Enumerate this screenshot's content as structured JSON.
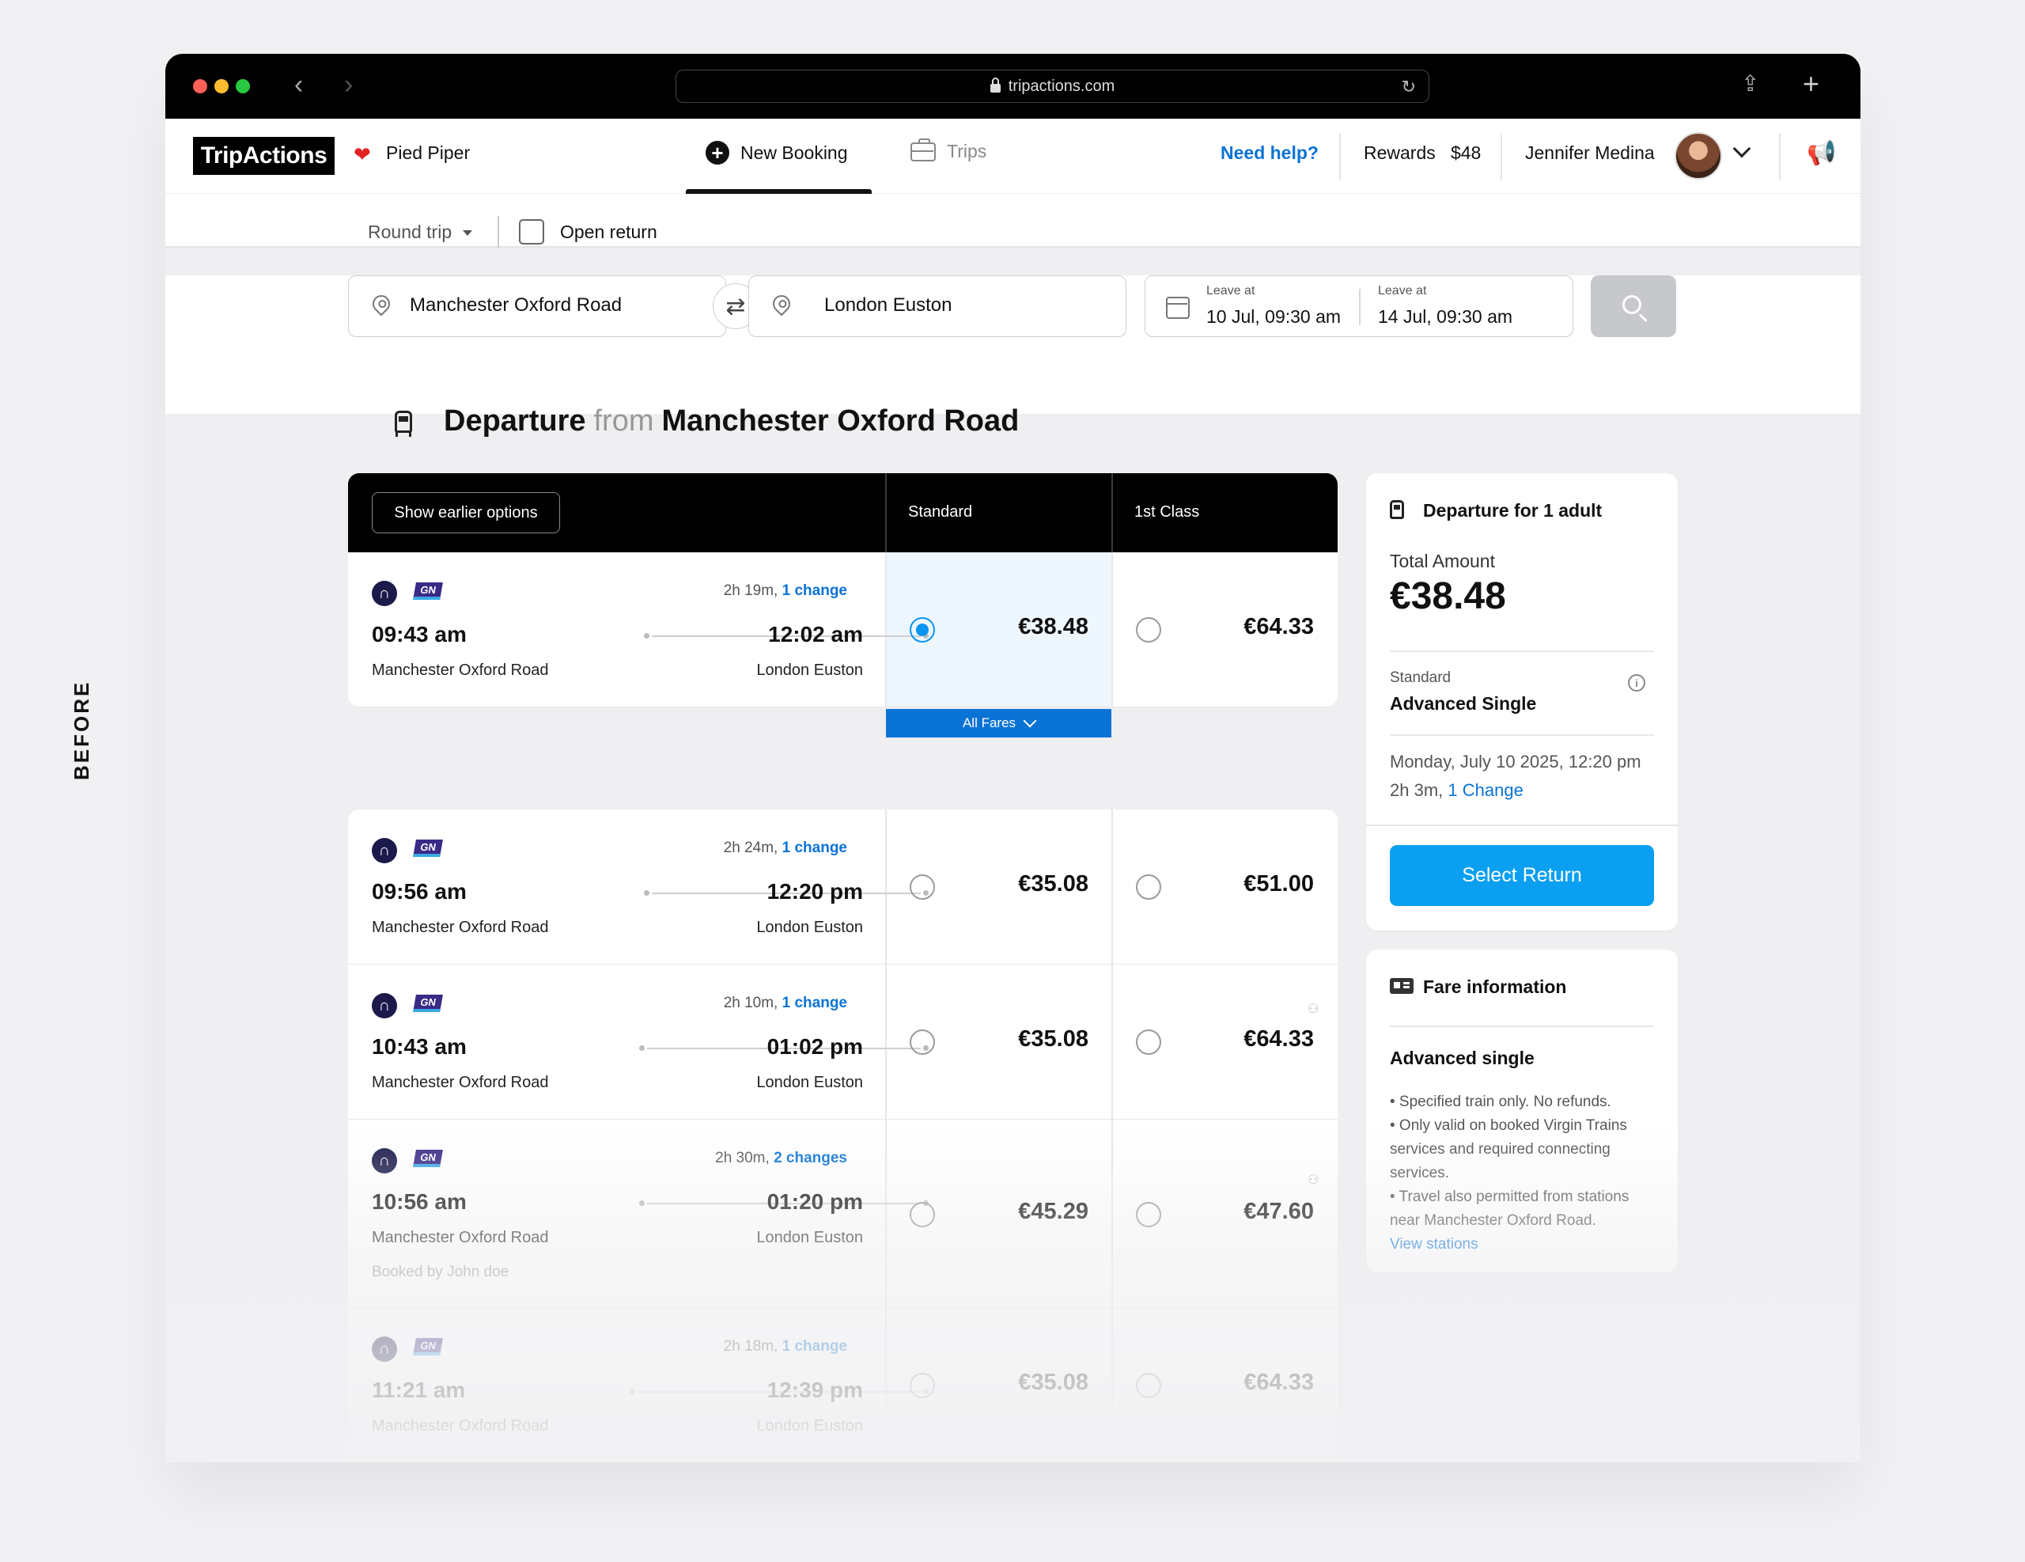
{
  "side_label": "BEFORE",
  "browser": {
    "url": "tripactions.com"
  },
  "topbar": {
    "logo": "TripActions",
    "company": "Pied Piper",
    "tab_new_booking": "New Booking",
    "tab_trips": "Trips",
    "need_help": "Need help?",
    "rewards_label": "Rewards",
    "rewards_value": "$48",
    "user_name": "Jennifer Medina"
  },
  "search": {
    "trip_type": "Round trip",
    "open_return": "Open return",
    "origin": "Manchester Oxford Road",
    "destination": "London Euston",
    "leave_label_1": "Leave at",
    "leave_value_1": "10 Jul, 09:30 am",
    "leave_label_2": "Leave at",
    "leave_value_2": "14 Jul, 09:30 am"
  },
  "heading": {
    "word1": "Departure",
    "word2": "from",
    "station": "Manchester Oxford Road"
  },
  "results": {
    "earlier_button": "Show earlier options",
    "col_standard": "Standard",
    "col_first": "1st Class",
    "all_fares": "All Fares",
    "operator_badge": "GN",
    "rows": [
      {
        "duration": "2h 19m,",
        "changes": "1 change",
        "dep": "09:43 am",
        "arr": "12:02 am",
        "from": "Manchester Oxford Road",
        "to": "London Euston",
        "std": "€38.48",
        "first": "€64.33",
        "booked": ""
      },
      {
        "duration": "2h 24m,",
        "changes": "1 change",
        "dep": "09:56 am",
        "arr": "12:20 pm",
        "from": "Manchester Oxford Road",
        "to": "London Euston",
        "std": "€35.08",
        "first": "€51.00",
        "booked": ""
      },
      {
        "duration": "2h 10m,",
        "changes": "1 change",
        "dep": "10:43 am",
        "arr": "01:02 pm",
        "from": "Manchester Oxford Road",
        "to": "London Euston",
        "std": "€35.08",
        "first": "€64.33",
        "booked": ""
      },
      {
        "duration": "2h 30m,",
        "changes": "2 changes",
        "dep": "10:56 am",
        "arr": "01:20 pm",
        "from": "Manchester Oxford Road",
        "to": "London Euston",
        "std": "€45.29",
        "first": "€47.60",
        "booked": "Booked by John doe"
      },
      {
        "duration": "2h 18m,",
        "changes": "1 change",
        "dep": "11:21 am",
        "arr": "12:39 pm",
        "from": "Manchester Oxford Road",
        "to": "London Euston",
        "std": "€35.08",
        "first": "€64.33",
        "booked": ""
      }
    ]
  },
  "summary": {
    "title": "Departure for 1 adult",
    "total_label": "Total Amount",
    "total_value": "€38.48",
    "class_label": "Standard",
    "fare_name": "Advanced Single",
    "date_line": "Monday, July 10 2025, 12:20 pm",
    "duration_line": "2h 3m,",
    "change_link": "1 Change",
    "select_return": "Select Return"
  },
  "fare_info": {
    "title": "Fare information",
    "fare_name": "Advanced single",
    "bullet1": "• Specified train only. No refunds.",
    "bullet2": "• Only valid on booked Virgin Trains services and required connecting services.",
    "bullet3": "• Travel also permitted from stations near Manchester Oxford Road.",
    "view_stations": "View stations"
  },
  "colors": {
    "accent": "#0a9ff0",
    "link": "#0a73d6",
    "header_bg": "#000000"
  }
}
